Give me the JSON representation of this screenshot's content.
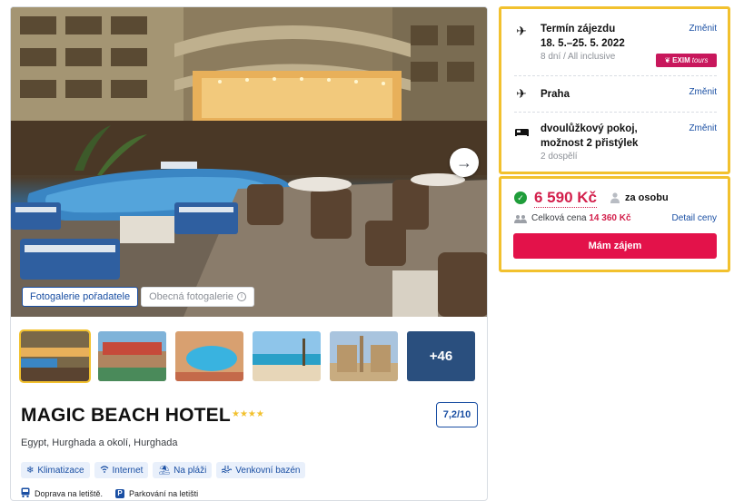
{
  "gallery": {
    "tabs": [
      {
        "label": "Fotogalerie pořadatele",
        "active": true
      },
      {
        "label": "Obecná fotogalerie",
        "active": false
      }
    ],
    "next_icon": "arrow-right-icon",
    "more_count": "+46"
  },
  "hotel": {
    "name": "MAGIC BEACH HOTEL",
    "stars": "★★★★",
    "star_count": 4,
    "rating": "7,2/10",
    "location": "Egypt, Hurghada a okolí, Hurghada",
    "amenities": [
      {
        "icon": "snowflake-icon",
        "label": "Klimatizace"
      },
      {
        "icon": "wifi-icon",
        "label": "Internet"
      },
      {
        "icon": "beach-icon",
        "label": "Na pláži"
      },
      {
        "icon": "pool-icon",
        "label": "Venkovní bazén"
      }
    ],
    "transport": [
      {
        "icon": "bus-icon",
        "label": "Doprava na letiště."
      },
      {
        "icon": "parking-icon",
        "label": "Parkování na letišti"
      }
    ]
  },
  "trip": {
    "term": {
      "title": "Termín zájezdu",
      "dates": "18. 5.–25. 5. 2022",
      "sub": "8 dní / All inclusive",
      "change": "Změnit",
      "operator": "EXIM",
      "operator_suffix": "tours"
    },
    "departure": {
      "title": "Praha",
      "change": "Změnit"
    },
    "room": {
      "title_line1": "dvoulůžkový pokoj,",
      "title_line2": "možnost 2 přistýlek",
      "sub": "2 dospělí",
      "change": "Změnit"
    }
  },
  "price": {
    "per_person_value": "6 590 Kč",
    "per_person_label": "za osobu",
    "total_label": "Celková cena",
    "total_value": "14 360 Kč",
    "detail_link": "Detail ceny",
    "cta": "Mám zájem"
  },
  "colors": {
    "accent_blue": "#1a4fa3",
    "highlight_yellow": "#f2c12e",
    "price_red": "#d3204c",
    "cta_red": "#e3124a",
    "success_green": "#1f9d3a"
  }
}
